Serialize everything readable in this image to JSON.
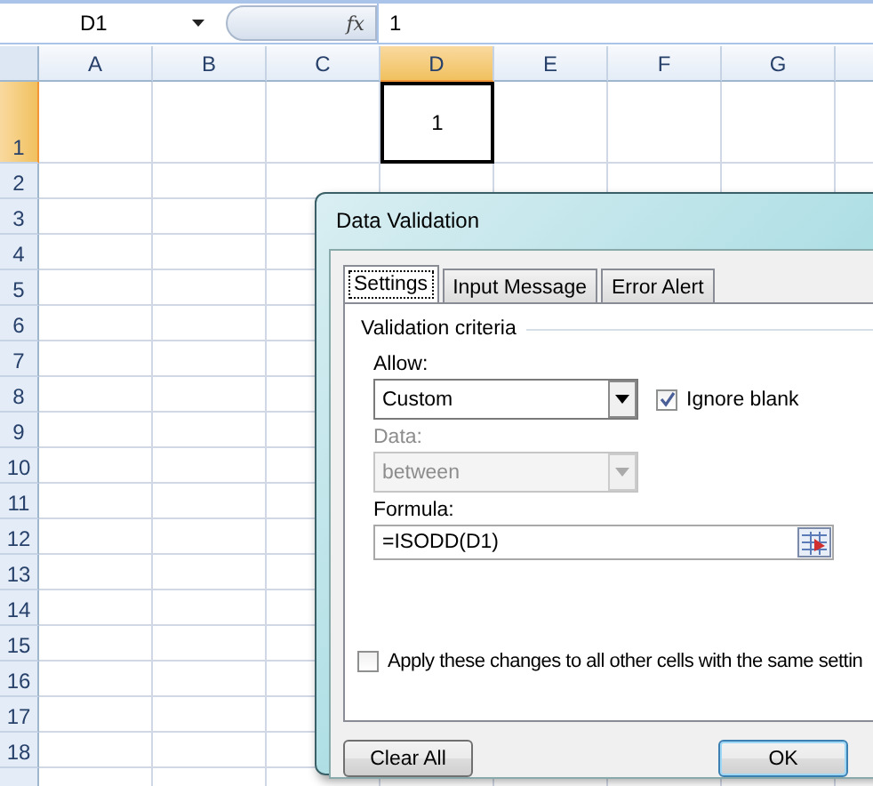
{
  "formula_bar": {
    "name_box": "D1",
    "fx": "fx",
    "formula": "1"
  },
  "columns": [
    {
      "label": "A",
      "selected": false
    },
    {
      "label": "B",
      "selected": false
    },
    {
      "label": "C",
      "selected": false
    },
    {
      "label": "D",
      "selected": true
    },
    {
      "label": "E",
      "selected": false
    },
    {
      "label": "F",
      "selected": false
    },
    {
      "label": "G",
      "selected": false
    }
  ],
  "rows": [
    {
      "label": "1",
      "selected": true,
      "value": "1"
    },
    {
      "label": "2",
      "selected": false
    },
    {
      "label": "3",
      "selected": false
    },
    {
      "label": "4",
      "selected": false
    },
    {
      "label": "5",
      "selected": false
    },
    {
      "label": "6",
      "selected": false
    },
    {
      "label": "7",
      "selected": false
    },
    {
      "label": "8",
      "selected": false
    },
    {
      "label": "9",
      "selected": false
    },
    {
      "label": "10",
      "selected": false
    },
    {
      "label": "11",
      "selected": false
    },
    {
      "label": "12",
      "selected": false
    },
    {
      "label": "13",
      "selected": false
    },
    {
      "label": "14",
      "selected": false
    },
    {
      "label": "15",
      "selected": false
    },
    {
      "label": "16",
      "selected": false
    },
    {
      "label": "17",
      "selected": false
    },
    {
      "label": "18",
      "selected": false
    }
  ],
  "dialog": {
    "title": "Data Validation",
    "tabs": [
      {
        "label": "Settings",
        "selected": true
      },
      {
        "label": "Input Message",
        "selected": false
      },
      {
        "label": "Error Alert",
        "selected": false
      }
    ],
    "section": "Validation criteria",
    "allow": {
      "label": "Allow:",
      "value": "Custom",
      "disabled": false
    },
    "ignore_blank": {
      "label": "Ignore blank",
      "checked": true
    },
    "data": {
      "label": "Data:",
      "value": "between",
      "disabled": true
    },
    "formula": {
      "label": "Formula:",
      "value": "=ISODD(D1)"
    },
    "apply_all": {
      "label": "Apply these changes to all other cells with the same settin",
      "checked": false
    },
    "buttons": [
      {
        "label": "Clear All",
        "default": false
      },
      {
        "label": "OK",
        "default": true
      }
    ]
  }
}
